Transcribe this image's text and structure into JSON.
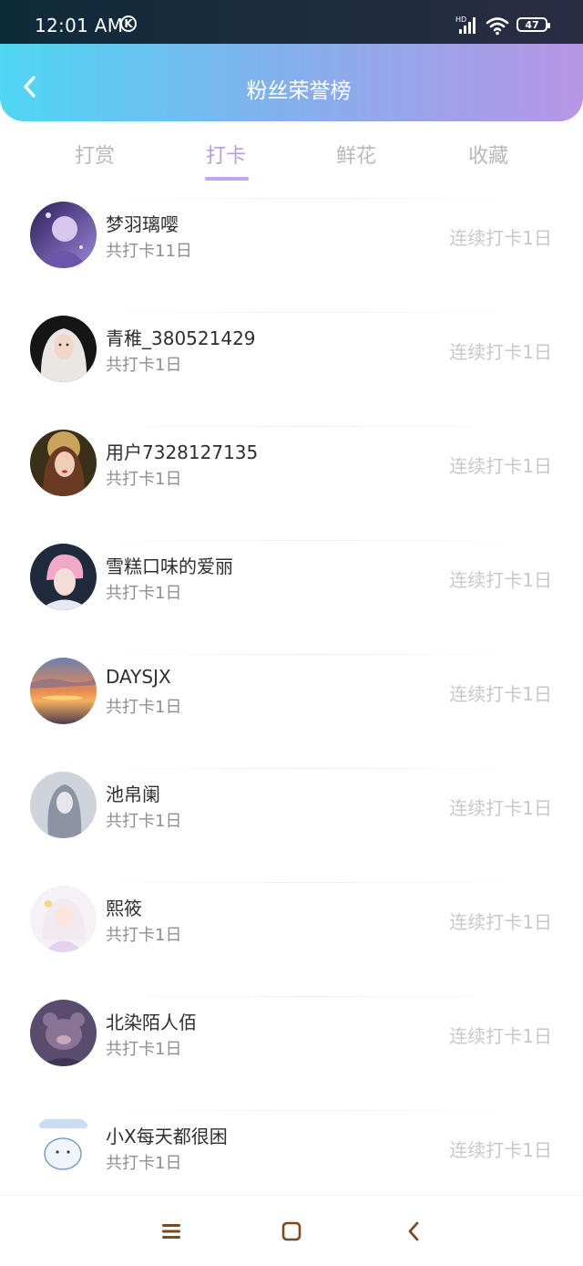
{
  "status_bar": {
    "time": "12:01 AM",
    "k_badge": "K",
    "battery": "47",
    "hd_label": "HD"
  },
  "header": {
    "title": "粉丝荣誉榜"
  },
  "tabs": [
    {
      "label": "打赏",
      "active": false
    },
    {
      "label": "打卡",
      "active": true
    },
    {
      "label": "鲜花",
      "active": false
    },
    {
      "label": "收藏",
      "active": false
    }
  ],
  "fans": [
    {
      "name": "梦羽璃嘤",
      "total": "共打卡11日",
      "streak": "连续打卡1日"
    },
    {
      "name": "青稚_380521429",
      "total": "共打卡1日",
      "streak": "连续打卡1日"
    },
    {
      "name": "用户7328127135",
      "total": "共打卡1日",
      "streak": "连续打卡1日"
    },
    {
      "name": "雪糕口味的爱丽",
      "total": "共打卡1日",
      "streak": "连续打卡1日"
    },
    {
      "name": "DAYSJX",
      "total": "共打卡1日",
      "streak": "连续打卡1日"
    },
    {
      "name": "池帛阑",
      "total": "共打卡1日",
      "streak": "连续打卡1日"
    },
    {
      "name": "熙筱",
      "total": "共打卡1日",
      "streak": "连续打卡1日"
    },
    {
      "name": "北染陌人佰",
      "total": "共打卡1日",
      "streak": "连续打卡1日"
    },
    {
      "name": "小X每天都很困",
      "total": "共打卡1日",
      "streak": "连续打卡1日"
    }
  ],
  "nav": {
    "icons": [
      "menu-icon",
      "home-square-icon",
      "back-triangle-icon"
    ]
  },
  "colors": {
    "accent": "#b99ae6",
    "header_start": "#4fd7f3",
    "header_end": "#b896e6"
  }
}
